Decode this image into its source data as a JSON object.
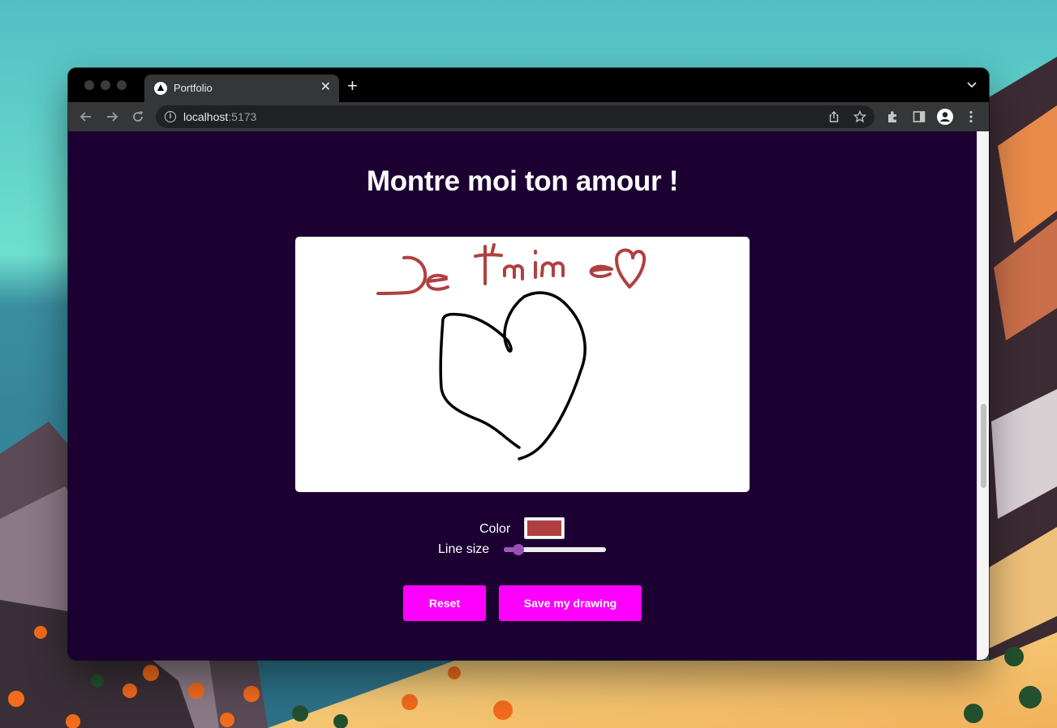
{
  "browser": {
    "tab_title": "Portfolio",
    "tab_close_glyph": "✕",
    "new_tab_glyph": "+",
    "url_host": "localhost",
    "url_port": ":5173"
  },
  "page": {
    "heading": "Montre moi ton amour !",
    "color_label": "Color",
    "color_value": "#b04040",
    "line_size_label": "Line size",
    "line_size_fraction": 0.1,
    "reset_label": "Reset",
    "save_label": "Save my drawing"
  },
  "colors": {
    "page_background": "#1c0032",
    "button_background": "#ff00ff",
    "drawing_black": "#000000",
    "drawing_red": "#b04040"
  }
}
